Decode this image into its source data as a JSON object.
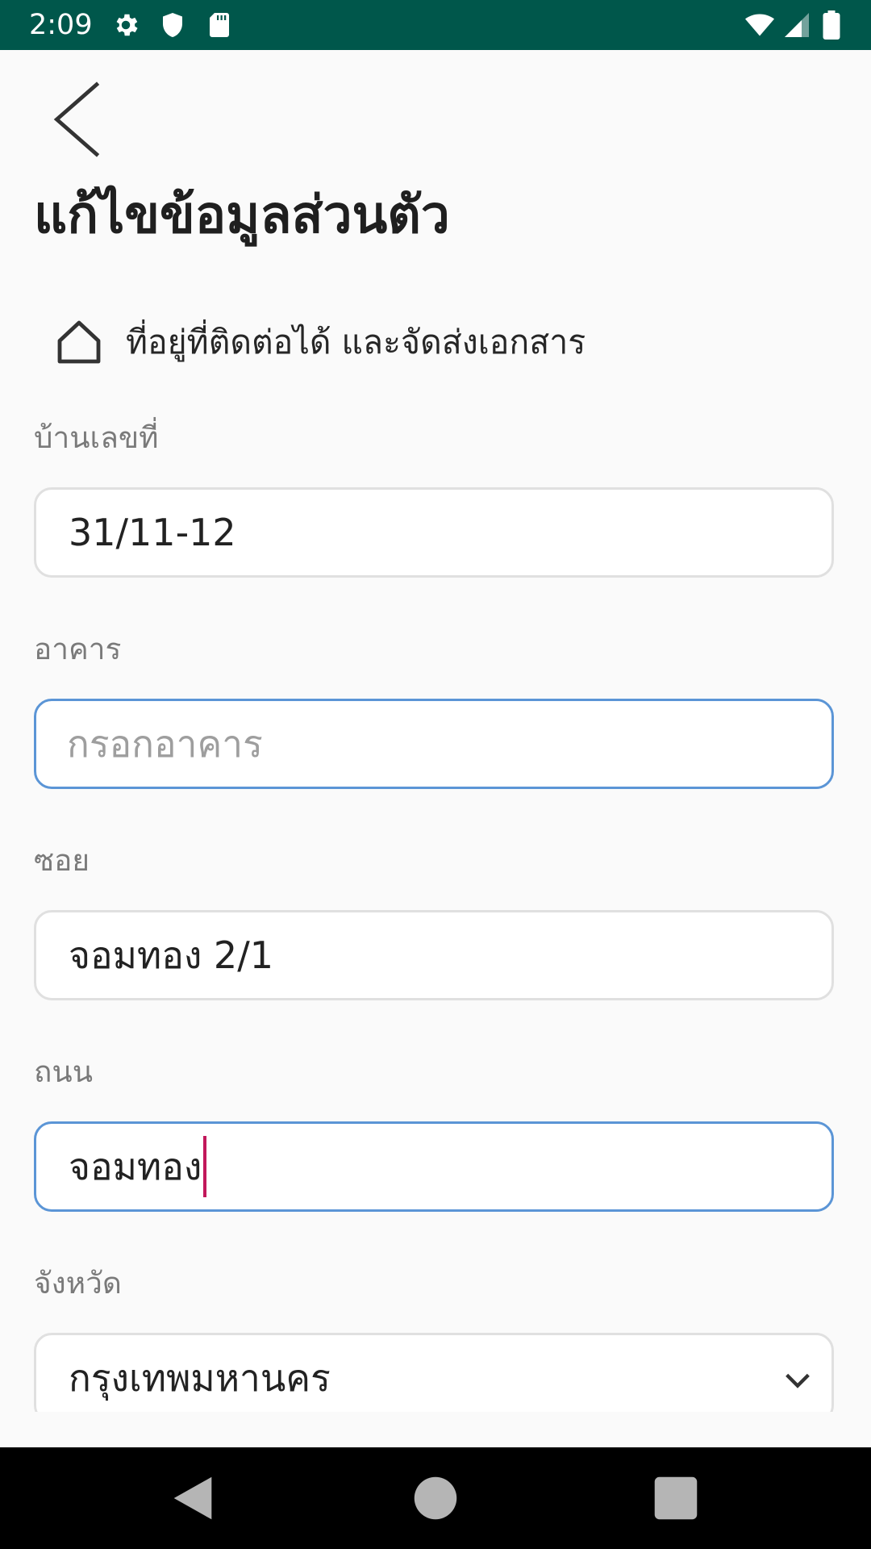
{
  "status_bar": {
    "time": "2:09",
    "background_color": "#00574b",
    "left_icons": [
      "gear-icon",
      "shield-icon",
      "sd-card-icon"
    ],
    "right_icons": [
      "wifi-icon",
      "cell-signal-icon",
      "battery-icon"
    ]
  },
  "header": {
    "back_icon": "chevron-left-icon",
    "title": "แก้ไขข้อมูลส่วนตัว"
  },
  "section": {
    "icon": "home-icon",
    "title": "ที่อยู่ที่ติดต่อได้ และจัดส่งเอกสาร"
  },
  "fields": {
    "house_number": {
      "label": "บ้านเลขที่",
      "value": "31/11-12"
    },
    "building": {
      "label": "อาคาร",
      "placeholder": "กรอกอาคาร",
      "value": ""
    },
    "soi": {
      "label": "ซอย",
      "value": "จอมทอง 2/1"
    },
    "road": {
      "label": "ถนน",
      "value": "จอมทอง"
    },
    "province": {
      "label": "จังหวัด",
      "value": "กรุงเทพมหานคร"
    }
  },
  "colors": {
    "focused_border": "#5b95d6",
    "caret": "#c2185b",
    "label": "#7a7a7a"
  },
  "nav_bar": {
    "buttons": [
      "back-triangle-icon",
      "home-circle-icon",
      "recents-square-icon"
    ]
  }
}
